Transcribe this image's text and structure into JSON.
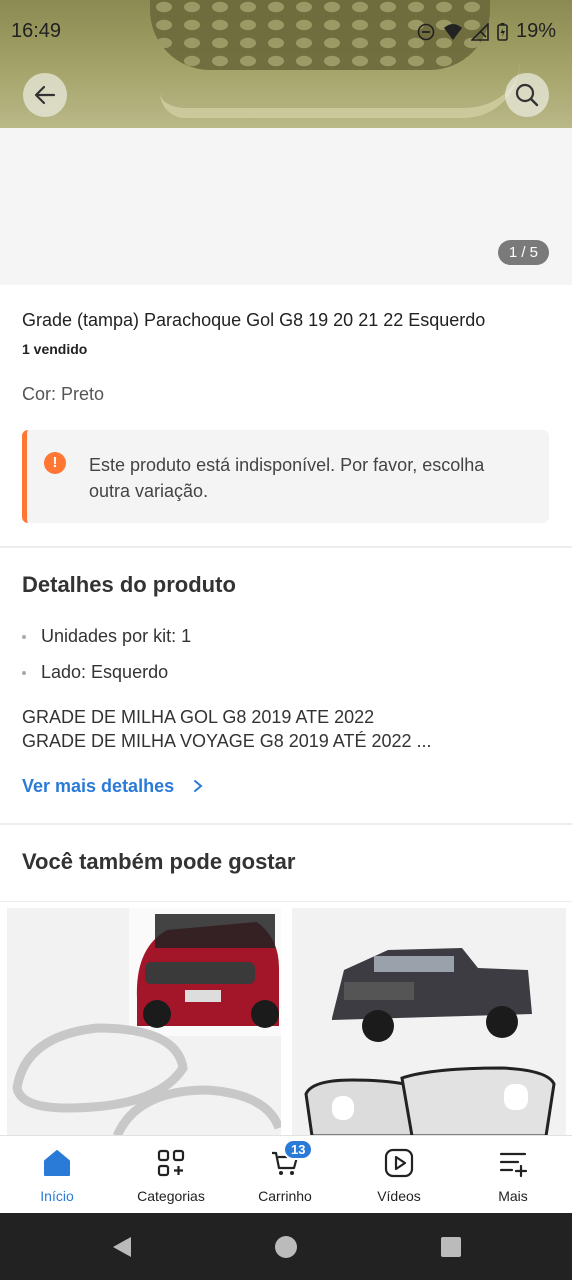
{
  "status_bar": {
    "time": "16:49",
    "battery": "19%"
  },
  "gallery": {
    "counter": "1 / 5"
  },
  "product": {
    "title": "Grade (tampa) Parachoque Gol G8 19 20 21 22 Esquerdo",
    "sold": "1 vendido",
    "color": "Cor: Preto",
    "alert": "Este produto está indisponível. Por favor, escolha outra variação."
  },
  "details": {
    "heading": "Detalhes do produto",
    "bullets": [
      "Unidades por kit: 1",
      "Lado: Esquerdo"
    ],
    "desc_line1": "GRADE DE MILHA GOL G8 2019 ATE 2022",
    "desc_line2": "GRADE DE MILHA VOYAGE G8 2019 ATÉ 2022 ...",
    "more_label": "Ver mais detalhes"
  },
  "recommend": {
    "heading": "Você também pode gostar"
  },
  "tabs": [
    {
      "label": "Início",
      "icon": "home-icon",
      "active": true
    },
    {
      "label": "Categorias",
      "icon": "categories-icon",
      "active": false
    },
    {
      "label": "Carrinho",
      "icon": "cart-icon",
      "active": false
    },
    {
      "label": "Vídeos",
      "icon": "video-icon",
      "active": false
    },
    {
      "label": "Mais",
      "icon": "menu-plus-icon",
      "active": false
    }
  ],
  "cart_badge": "13",
  "colors": {
    "accent": "#2a7ad8",
    "warning": "#ff7733"
  }
}
